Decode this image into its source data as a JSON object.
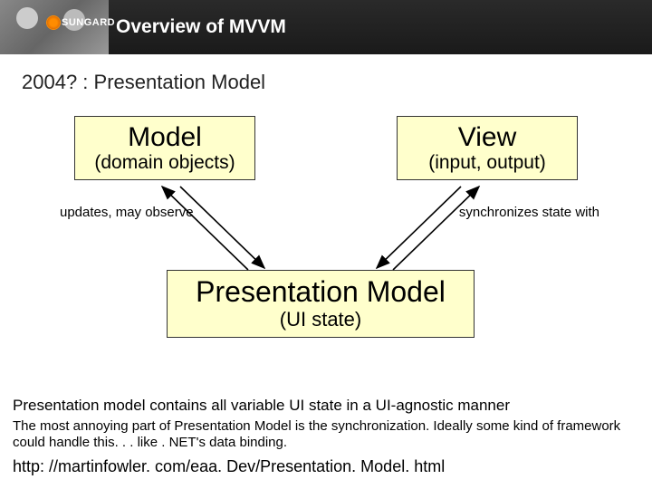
{
  "header": {
    "brand": "SUNGARD",
    "title": "Overview of MVVM"
  },
  "subtitle": "2004? : Presentation Model",
  "boxes": {
    "model": {
      "title": "Model",
      "sub": "(domain objects)"
    },
    "view": {
      "title": "View",
      "sub": "(input, output)"
    },
    "pm": {
      "title": "Presentation Model",
      "sub": "(UI state)"
    }
  },
  "labels": {
    "left": "updates, may observe",
    "right": "synchronizes state with"
  },
  "footer": {
    "line1": "Presentation model contains all variable UI state in a UI-agnostic manner",
    "line2": "The most annoying part of Presentation Model is the synchronization. Ideally some kind of framework could handle this. . . like . NET's data binding.",
    "url": "http: //martinfowler. com/eaa. Dev/Presentation. Model. html"
  }
}
